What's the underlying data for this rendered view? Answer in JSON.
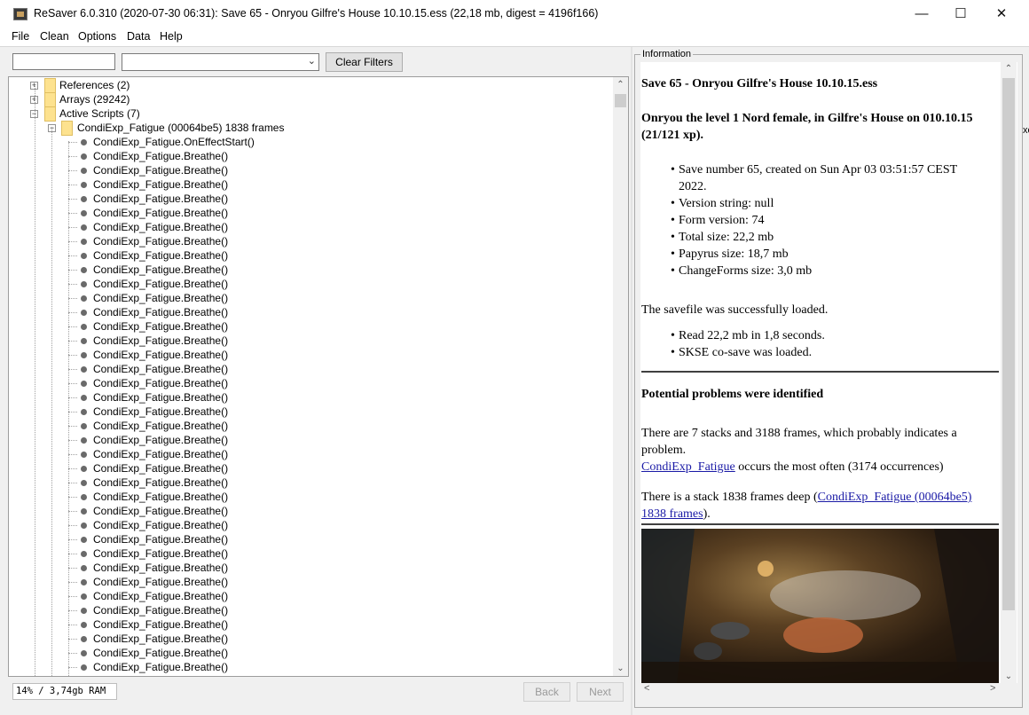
{
  "window": {
    "title": "ReSaver 6.0.310 (2020-07-30 06:31): Save 65 - Onryou  Gilfre's House  10.10.15.ess (22,18 mb, digest = 4196f166)",
    "minimize_glyph": "—",
    "maximize_glyph": "☐",
    "close_glyph": "✕"
  },
  "menu": [
    "File",
    "Clean",
    "Options",
    "Data",
    "Help"
  ],
  "filter": {
    "text_value": "",
    "combo_value": "",
    "clear_label": "Clear Filters"
  },
  "tree": {
    "nodes": [
      {
        "label": "References (2)",
        "kind": "folder",
        "depth": 0,
        "expander": "+"
      },
      {
        "label": "Arrays (29242)",
        "kind": "folder",
        "depth": 0,
        "expander": "+"
      },
      {
        "label": "Active Scripts (7)",
        "kind": "folder",
        "depth": 0,
        "expander": "−"
      },
      {
        "label": "CondiExp_Fatigue (00064be5) 1838 frames",
        "kind": "folder",
        "depth": 1,
        "expander": "−"
      },
      {
        "label": "CondiExp_Fatigue.OnEffectStart()",
        "kind": "leaf",
        "depth": 2
      },
      {
        "label": "CondiExp_Fatigue.Breathe()",
        "kind": "leaf",
        "depth": 2
      },
      {
        "label": "CondiExp_Fatigue.Breathe()",
        "kind": "leaf",
        "depth": 2
      },
      {
        "label": "CondiExp_Fatigue.Breathe()",
        "kind": "leaf",
        "depth": 2
      },
      {
        "label": "CondiExp_Fatigue.Breathe()",
        "kind": "leaf",
        "depth": 2
      },
      {
        "label": "CondiExp_Fatigue.Breathe()",
        "kind": "leaf",
        "depth": 2
      },
      {
        "label": "CondiExp_Fatigue.Breathe()",
        "kind": "leaf",
        "depth": 2
      },
      {
        "label": "CondiExp_Fatigue.Breathe()",
        "kind": "leaf",
        "depth": 2
      },
      {
        "label": "CondiExp_Fatigue.Breathe()",
        "kind": "leaf",
        "depth": 2
      },
      {
        "label": "CondiExp_Fatigue.Breathe()",
        "kind": "leaf",
        "depth": 2
      },
      {
        "label": "CondiExp_Fatigue.Breathe()",
        "kind": "leaf",
        "depth": 2
      },
      {
        "label": "CondiExp_Fatigue.Breathe()",
        "kind": "leaf",
        "depth": 2
      },
      {
        "label": "CondiExp_Fatigue.Breathe()",
        "kind": "leaf",
        "depth": 2
      },
      {
        "label": "CondiExp_Fatigue.Breathe()",
        "kind": "leaf",
        "depth": 2
      },
      {
        "label": "CondiExp_Fatigue.Breathe()",
        "kind": "leaf",
        "depth": 2
      },
      {
        "label": "CondiExp_Fatigue.Breathe()",
        "kind": "leaf",
        "depth": 2
      },
      {
        "label": "CondiExp_Fatigue.Breathe()",
        "kind": "leaf",
        "depth": 2
      },
      {
        "label": "CondiExp_Fatigue.Breathe()",
        "kind": "leaf",
        "depth": 2
      },
      {
        "label": "CondiExp_Fatigue.Breathe()",
        "kind": "leaf",
        "depth": 2
      },
      {
        "label": "CondiExp_Fatigue.Breathe()",
        "kind": "leaf",
        "depth": 2
      },
      {
        "label": "CondiExp_Fatigue.Breathe()",
        "kind": "leaf",
        "depth": 2
      },
      {
        "label": "CondiExp_Fatigue.Breathe()",
        "kind": "leaf",
        "depth": 2
      },
      {
        "label": "CondiExp_Fatigue.Breathe()",
        "kind": "leaf",
        "depth": 2
      },
      {
        "label": "CondiExp_Fatigue.Breathe()",
        "kind": "leaf",
        "depth": 2
      },
      {
        "label": "CondiExp_Fatigue.Breathe()",
        "kind": "leaf",
        "depth": 2
      },
      {
        "label": "CondiExp_Fatigue.Breathe()",
        "kind": "leaf",
        "depth": 2
      },
      {
        "label": "CondiExp_Fatigue.Breathe()",
        "kind": "leaf",
        "depth": 2
      },
      {
        "label": "CondiExp_Fatigue.Breathe()",
        "kind": "leaf",
        "depth": 2
      },
      {
        "label": "CondiExp_Fatigue.Breathe()",
        "kind": "leaf",
        "depth": 2
      },
      {
        "label": "CondiExp_Fatigue.Breathe()",
        "kind": "leaf",
        "depth": 2
      },
      {
        "label": "CondiExp_Fatigue.Breathe()",
        "kind": "leaf",
        "depth": 2
      },
      {
        "label": "CondiExp_Fatigue.Breathe()",
        "kind": "leaf",
        "depth": 2
      },
      {
        "label": "CondiExp_Fatigue.Breathe()",
        "kind": "leaf",
        "depth": 2
      },
      {
        "label": "CondiExp_Fatigue.Breathe()",
        "kind": "leaf",
        "depth": 2
      },
      {
        "label": "CondiExp_Fatigue.Breathe()",
        "kind": "leaf",
        "depth": 2
      },
      {
        "label": "CondiExp_Fatigue.Breathe()",
        "kind": "leaf",
        "depth": 2
      },
      {
        "label": "CondiExp_Fatigue.Breathe()",
        "kind": "leaf",
        "depth": 2
      },
      {
        "label": "CondiExp_Fatigue.Breathe()",
        "kind": "leaf",
        "depth": 2
      },
      {
        "label": "CondiExp_Fatigue.Breathe()",
        "kind": "leaf",
        "depth": 2
      },
      {
        "label": "CondiExp_Fatigue.Breathe()",
        "kind": "leaf",
        "depth": 2
      },
      {
        "label": "CondiExp_Fatigue.Breathe()",
        "kind": "leaf",
        "depth": 2
      }
    ]
  },
  "status": {
    "memory": "14% / 3,74gb RAM"
  },
  "nav": {
    "back_label": "Back",
    "next_label": "Next"
  },
  "info": {
    "legend": "Information",
    "heading": "Save 65 - Onryou Gilfre's House 10.10.15.ess",
    "subheading": "Onryou the level 1 Nord female, in Gilfre's House on 010.10.15 (21/121 xp).",
    "details": [
      "Save number 65, created on Sun Apr 03 03:51:57 CEST 2022.",
      "Version string: null",
      "Form version: 74",
      "Total size: 22,2 mb",
      "Papyrus size: 18,7 mb",
      "ChangeForms size: 3,0 mb"
    ],
    "load_text": "The savefile was successfully loaded.",
    "load_details": [
      "Read 22,2 mb in 1,8 seconds.",
      "SKSE co-save was loaded."
    ],
    "problems_heading": "Potential problems were identified",
    "stacks_text": "There are 7 stacks and 3188 frames, which probably indicates a problem.",
    "often_link": "CondiExp_Fatigue",
    "often_text": " occurs the most often (3174 occurrences)",
    "deep_prefix": "There is a stack 1838 frames deep (",
    "deep_link": "CondiExp_Fatigue (00064be5) 1838 frames",
    "deep_suffix": ")."
  },
  "edge_fragment": "xe"
}
